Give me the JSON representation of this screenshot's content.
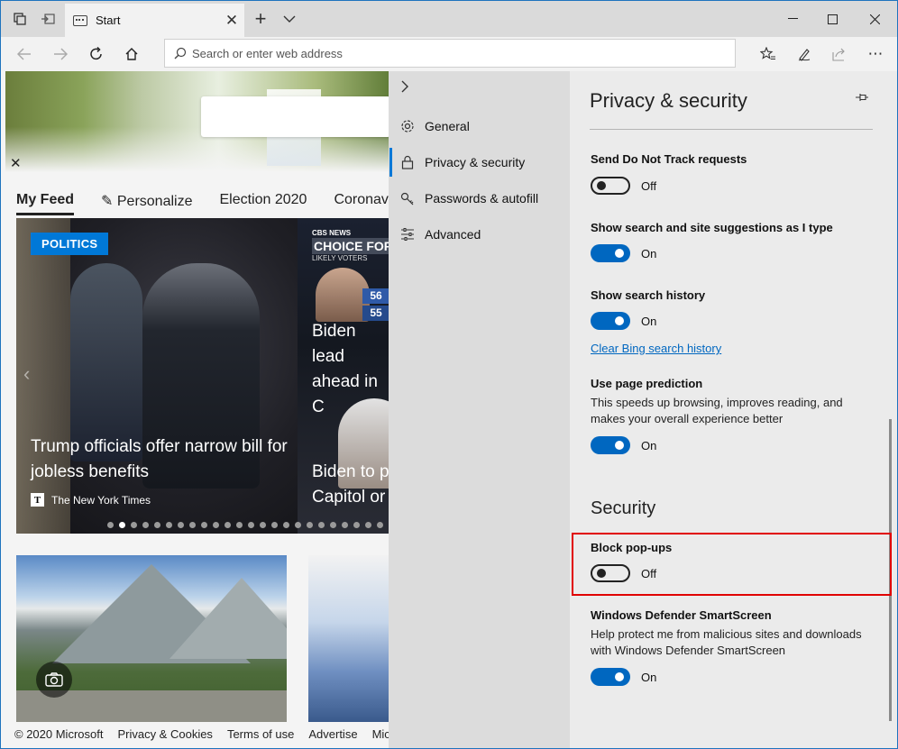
{
  "browser": {
    "tab_title": "Start",
    "address_placeholder": "Search or enter web address"
  },
  "page": {
    "feed_tabs": [
      "My Feed",
      "Personalize",
      "Election 2020",
      "Coronavi"
    ],
    "main_story": {
      "category": "POLITICS",
      "headline": "Trump officials offer narrow bill for jobless benefits",
      "source": "The New York Times"
    },
    "second_story": {
      "network": "CBS NEWS BATTLEGRO",
      "banner": "CHOICE FOR P",
      "subtitle": "LIKELY VOTERS",
      "poll_a": "56",
      "poll_b": "55",
      "headline_1": "Biden lead ahead in C",
      "headline_2": "Biden to p Capitol or"
    },
    "carousel_dots": 24,
    "carousel_active_dot": 1,
    "footer": [
      "© 2020 Microsoft",
      "Privacy & Cookies",
      "Terms of use",
      "Advertise",
      "Mic"
    ]
  },
  "settings_nav": {
    "items": [
      {
        "label": "General",
        "icon": "gear-icon"
      },
      {
        "label": "Privacy & security",
        "icon": "lock-icon"
      },
      {
        "label": "Passwords & autofill",
        "icon": "key-icon"
      },
      {
        "label": "Advanced",
        "icon": "sliders-icon"
      }
    ],
    "active": "Privacy & security"
  },
  "panel": {
    "title": "Privacy & security",
    "dnt": {
      "label": "Send Do Not Track requests",
      "state": "Off"
    },
    "suggestions": {
      "label": "Show search and site suggestions as I type",
      "state": "On"
    },
    "history": {
      "label": "Show search history",
      "state": "On"
    },
    "clear_link": "Clear Bing search history",
    "prediction": {
      "label": "Use page prediction",
      "desc": "This speeds up browsing, improves reading, and makes your overall experience better",
      "state": "On"
    },
    "security_heading": "Security",
    "popups": {
      "label": "Block pop-ups",
      "state": "Off"
    },
    "smartscreen": {
      "label": "Windows Defender SmartScreen",
      "desc": "Help protect me from malicious sites and downloads with Windows Defender SmartScreen",
      "state": "On"
    }
  },
  "colors": {
    "accent": "#0067c0",
    "highlight": "#e00000"
  }
}
